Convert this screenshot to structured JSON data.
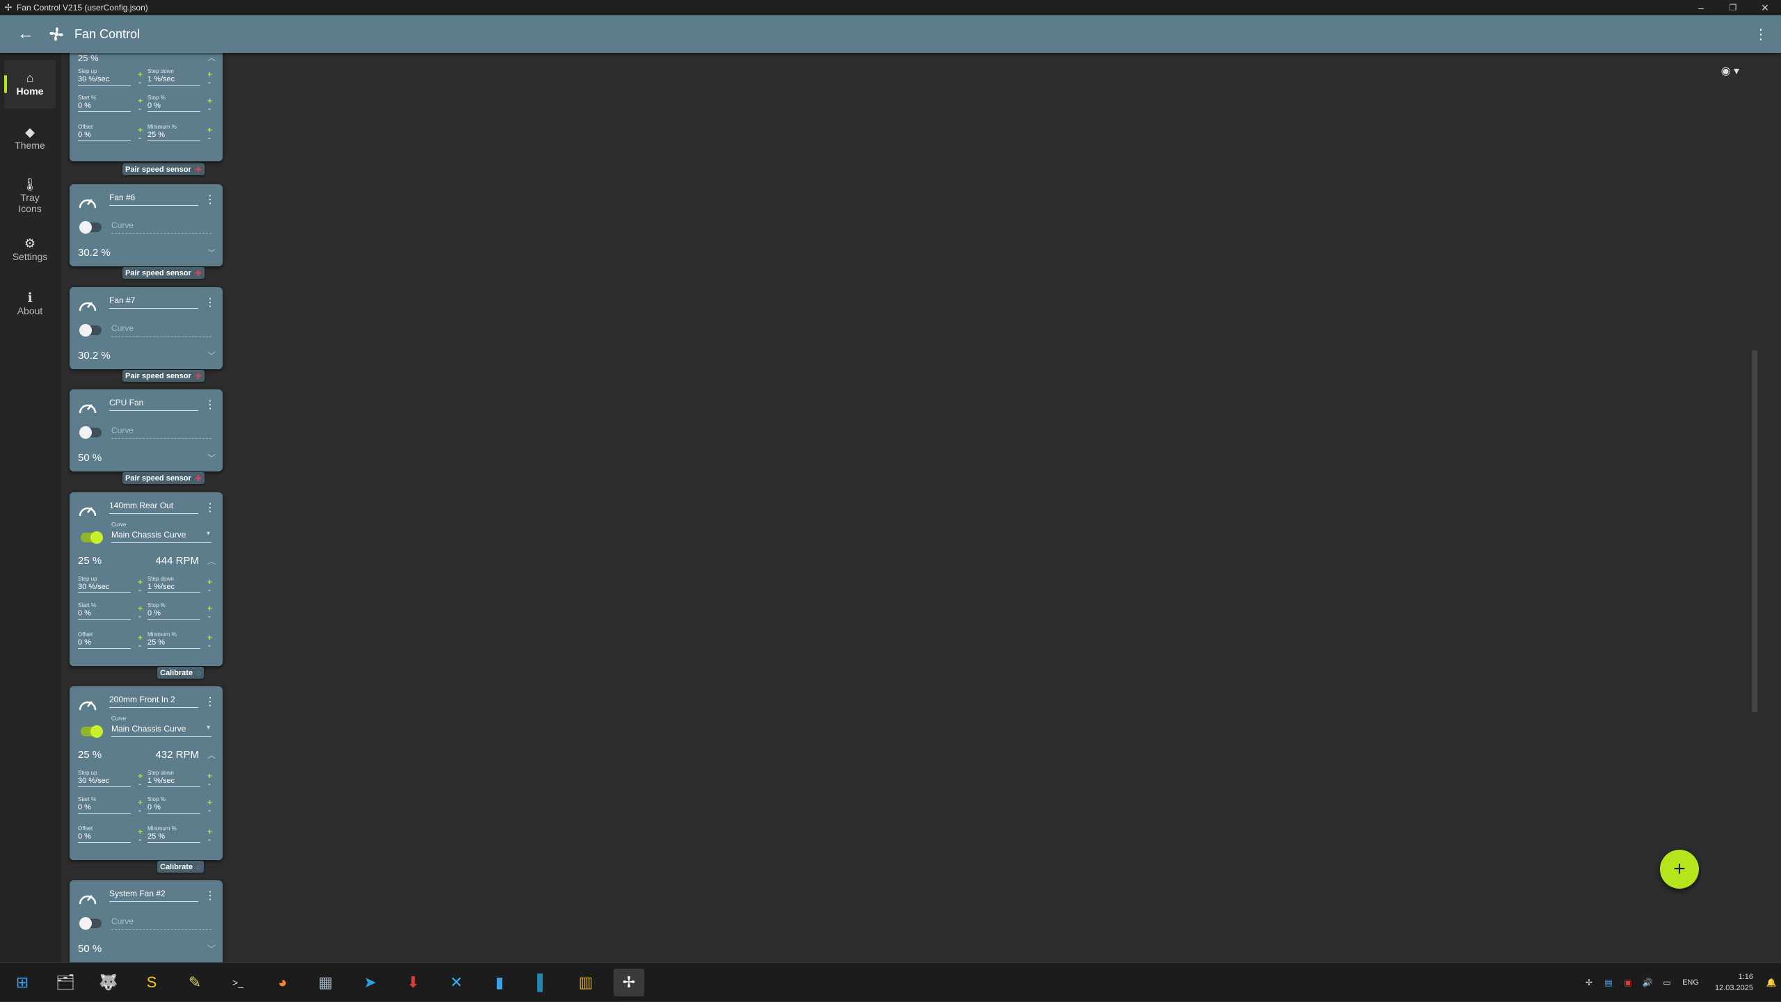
{
  "window": {
    "title": "Fan Control V215 (userConfig.json)",
    "minimize": "–",
    "maximize": "❐",
    "close": "✕"
  },
  "appbar": {
    "title": "Fan Control",
    "back_icon": "←",
    "more_icon": "⋮"
  },
  "sidebar": {
    "items": [
      {
        "label": "Home",
        "icon": "⌂"
      },
      {
        "label": "Theme",
        "icon": "◆"
      },
      {
        "label": "Tray Icons",
        "icon": "🌡"
      },
      {
        "label": "Settings",
        "icon": "⚙"
      },
      {
        "label": "About",
        "icon": "ℹ"
      }
    ]
  },
  "ui": {
    "plus": "+",
    "minus": "-",
    "kebab": "⋮",
    "chev_down": "﹀",
    "chev_up": "︿",
    "curve_placeholder": "Curve",
    "curve_label": "Curve",
    "dropdown_arrow": "▾",
    "pair_label": "Pair speed sensor",
    "pair_icon": "✚",
    "calibrate_label": "Calibrate",
    "calibrate_icon": "◌",
    "eye_icon": "◉ ▾",
    "fab_icon": "+"
  },
  "labels": {
    "step_up": "Step up",
    "step_down": "Step down",
    "start": "Start %",
    "stop": "Stop %",
    "offset": "Offset",
    "minimum": "Minimum %"
  },
  "partial_card": {
    "pct": "25 %",
    "step_up": "30 %/sec",
    "step_down": "1 %/sec",
    "start": "0 %",
    "stop": "0 %",
    "offset": "0 %",
    "minimum": "25 %"
  },
  "cards": [
    {
      "name": "Fan #6",
      "pct": "30.2 %"
    },
    {
      "name": "Fan #7",
      "pct": "30.2 %"
    },
    {
      "name": "CPU Fan",
      "pct": "50 %"
    },
    {
      "name": "140mm Rear Out",
      "curve": "Main Chassis Curve",
      "pct": "25 %",
      "rpm": "444 RPM",
      "step_up": "30 %/sec",
      "step_down": "1 %/sec",
      "start": "0 %",
      "stop": "0 %",
      "offset": "0 %",
      "minimum": "25 %"
    },
    {
      "name": "200mm Front In 2",
      "curve": "Main Chassis Curve",
      "pct": "25 %",
      "rpm": "432 RPM",
      "step_up": "30 %/sec",
      "step_down": "1 %/sec",
      "start": "0 %",
      "stop": "0 %",
      "offset": "0 %",
      "minimum": "25 %"
    },
    {
      "name": "System Fan #2",
      "pct": "50 %"
    }
  ],
  "taskbar": {
    "apps": [
      {
        "name": "start",
        "glyph": "⊞",
        "color": "#3ea0f0"
      },
      {
        "name": "explorer",
        "glyph": "🗂",
        "color": "#cfcfcf"
      },
      {
        "name": "wolf",
        "glyph": "🐺",
        "color": "#ffffff"
      },
      {
        "name": "s-app",
        "glyph": "S",
        "color": "#f5c518"
      },
      {
        "name": "pen",
        "glyph": "✎",
        "color": "#e0d060"
      },
      {
        "name": "terminal",
        "glyph": ">_",
        "color": "#dddddd"
      },
      {
        "name": "firefox",
        "glyph": "◕",
        "color": "#ff8a2a"
      },
      {
        "name": "image-app",
        "glyph": "▦",
        "color": "#9ab"
      },
      {
        "name": "telegram",
        "glyph": "➤",
        "color": "#2aa3e6"
      },
      {
        "name": "download",
        "glyph": "⬇",
        "color": "#e23a3a"
      },
      {
        "name": "x-app",
        "glyph": "✕",
        "color": "#31b3f2"
      },
      {
        "name": "bars-app",
        "glyph": "▮",
        "color": "#3aa0e8"
      },
      {
        "name": "panel-app",
        "glyph": "▌",
        "color": "#1f8bb5"
      },
      {
        "name": "chart-app",
        "glyph": "▥",
        "color": "#d6a020"
      },
      {
        "name": "fancontrol",
        "glyph": "✢",
        "color": "#ffffff"
      }
    ],
    "tray": {
      "fan": "✢",
      "net": "▤",
      "shield": "▣",
      "volume": "🔊",
      "display": "▭",
      "lang": "ENG",
      "time": "1:16",
      "date": "12.03.2025",
      "bell": "🔔"
    }
  }
}
